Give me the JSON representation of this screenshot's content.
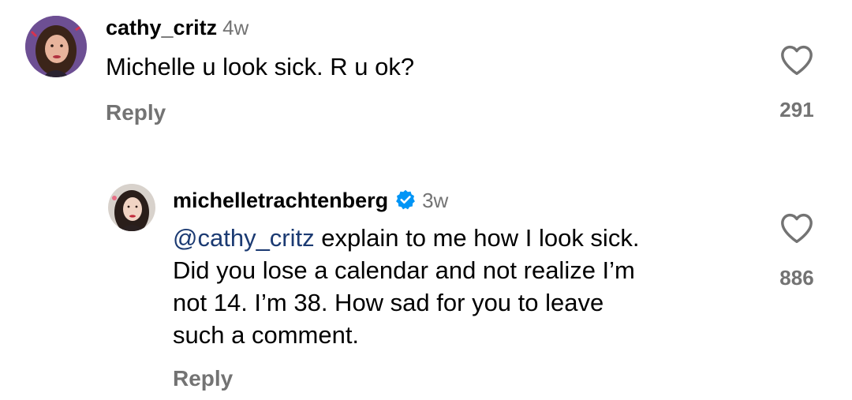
{
  "comments": [
    {
      "username": "cathy_critz",
      "timestamp": "4w",
      "text": "Michelle u look sick. R u ok?",
      "reply_label": "Reply",
      "like_count": "291",
      "verified": false
    },
    {
      "username": "michelletrachtenberg",
      "timestamp": "3w",
      "mention": "@cathy_critz",
      "text_lines": [
        " explain to me how I look sick.",
        "Did you lose a calendar and not realize I’m",
        "not 14. I’m 38. How sad for you to leave",
        "such a comment."
      ],
      "reply_label": "Reply",
      "like_count": "886",
      "verified": true
    }
  ],
  "icons": {
    "like": "heart-outline-icon",
    "verified": "verified-badge-icon"
  },
  "colors": {
    "secondary_text": "#737373",
    "mention": "#1b3a72",
    "verified_badge": "#0095f6"
  }
}
